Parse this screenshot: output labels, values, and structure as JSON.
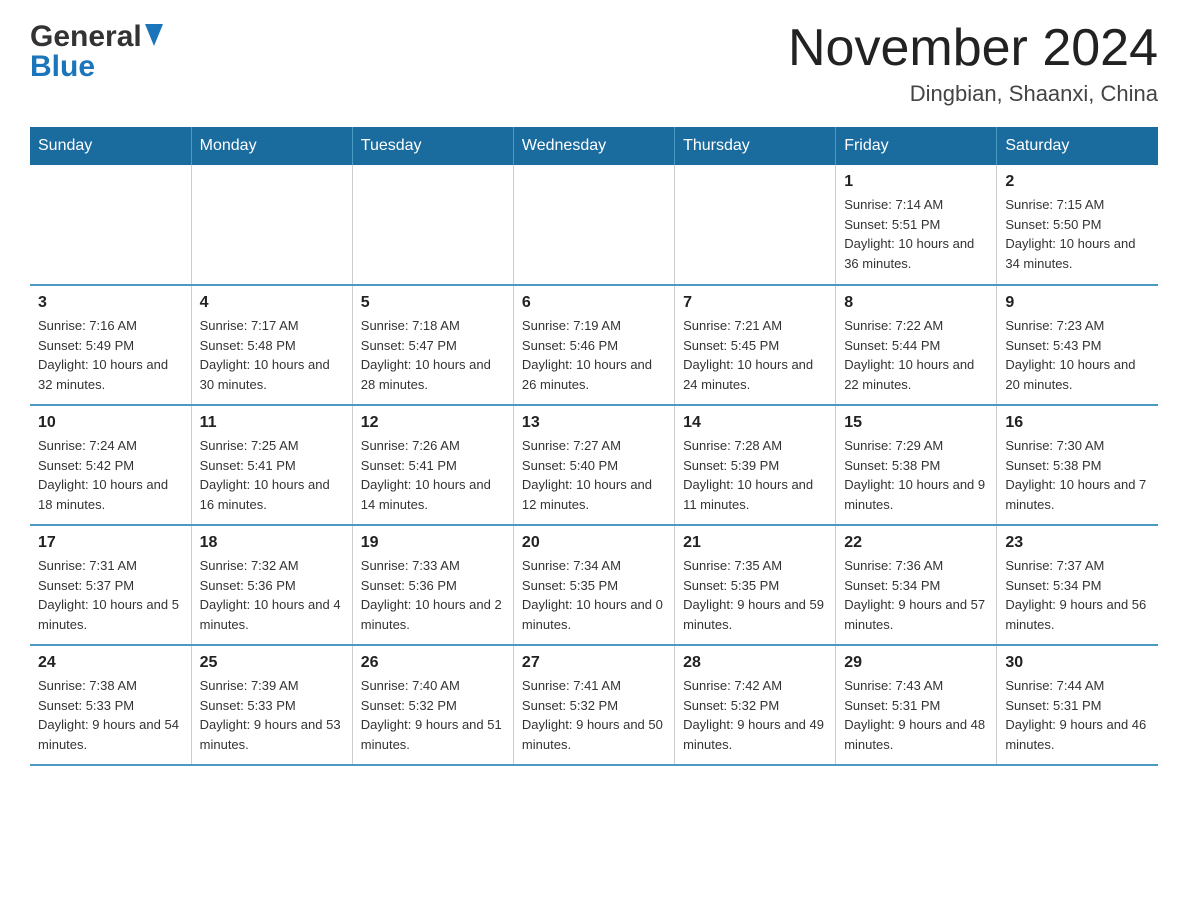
{
  "header": {
    "logo_general": "General",
    "logo_blue": "Blue",
    "month_title": "November 2024",
    "location": "Dingbian, Shaanxi, China"
  },
  "weekdays": [
    "Sunday",
    "Monday",
    "Tuesday",
    "Wednesday",
    "Thursday",
    "Friday",
    "Saturday"
  ],
  "weeks": [
    {
      "days": [
        {
          "num": "",
          "sunrise": "",
          "sunset": "",
          "daylight": ""
        },
        {
          "num": "",
          "sunrise": "",
          "sunset": "",
          "daylight": ""
        },
        {
          "num": "",
          "sunrise": "",
          "sunset": "",
          "daylight": ""
        },
        {
          "num": "",
          "sunrise": "",
          "sunset": "",
          "daylight": ""
        },
        {
          "num": "",
          "sunrise": "",
          "sunset": "",
          "daylight": ""
        },
        {
          "num": "1",
          "sunrise": "Sunrise: 7:14 AM",
          "sunset": "Sunset: 5:51 PM",
          "daylight": "Daylight: 10 hours and 36 minutes."
        },
        {
          "num": "2",
          "sunrise": "Sunrise: 7:15 AM",
          "sunset": "Sunset: 5:50 PM",
          "daylight": "Daylight: 10 hours and 34 minutes."
        }
      ]
    },
    {
      "days": [
        {
          "num": "3",
          "sunrise": "Sunrise: 7:16 AM",
          "sunset": "Sunset: 5:49 PM",
          "daylight": "Daylight: 10 hours and 32 minutes."
        },
        {
          "num": "4",
          "sunrise": "Sunrise: 7:17 AM",
          "sunset": "Sunset: 5:48 PM",
          "daylight": "Daylight: 10 hours and 30 minutes."
        },
        {
          "num": "5",
          "sunrise": "Sunrise: 7:18 AM",
          "sunset": "Sunset: 5:47 PM",
          "daylight": "Daylight: 10 hours and 28 minutes."
        },
        {
          "num": "6",
          "sunrise": "Sunrise: 7:19 AM",
          "sunset": "Sunset: 5:46 PM",
          "daylight": "Daylight: 10 hours and 26 minutes."
        },
        {
          "num": "7",
          "sunrise": "Sunrise: 7:21 AM",
          "sunset": "Sunset: 5:45 PM",
          "daylight": "Daylight: 10 hours and 24 minutes."
        },
        {
          "num": "8",
          "sunrise": "Sunrise: 7:22 AM",
          "sunset": "Sunset: 5:44 PM",
          "daylight": "Daylight: 10 hours and 22 minutes."
        },
        {
          "num": "9",
          "sunrise": "Sunrise: 7:23 AM",
          "sunset": "Sunset: 5:43 PM",
          "daylight": "Daylight: 10 hours and 20 minutes."
        }
      ]
    },
    {
      "days": [
        {
          "num": "10",
          "sunrise": "Sunrise: 7:24 AM",
          "sunset": "Sunset: 5:42 PM",
          "daylight": "Daylight: 10 hours and 18 minutes."
        },
        {
          "num": "11",
          "sunrise": "Sunrise: 7:25 AM",
          "sunset": "Sunset: 5:41 PM",
          "daylight": "Daylight: 10 hours and 16 minutes."
        },
        {
          "num": "12",
          "sunrise": "Sunrise: 7:26 AM",
          "sunset": "Sunset: 5:41 PM",
          "daylight": "Daylight: 10 hours and 14 minutes."
        },
        {
          "num": "13",
          "sunrise": "Sunrise: 7:27 AM",
          "sunset": "Sunset: 5:40 PM",
          "daylight": "Daylight: 10 hours and 12 minutes."
        },
        {
          "num": "14",
          "sunrise": "Sunrise: 7:28 AM",
          "sunset": "Sunset: 5:39 PM",
          "daylight": "Daylight: 10 hours and 11 minutes."
        },
        {
          "num": "15",
          "sunrise": "Sunrise: 7:29 AM",
          "sunset": "Sunset: 5:38 PM",
          "daylight": "Daylight: 10 hours and 9 minutes."
        },
        {
          "num": "16",
          "sunrise": "Sunrise: 7:30 AM",
          "sunset": "Sunset: 5:38 PM",
          "daylight": "Daylight: 10 hours and 7 minutes."
        }
      ]
    },
    {
      "days": [
        {
          "num": "17",
          "sunrise": "Sunrise: 7:31 AM",
          "sunset": "Sunset: 5:37 PM",
          "daylight": "Daylight: 10 hours and 5 minutes."
        },
        {
          "num": "18",
          "sunrise": "Sunrise: 7:32 AM",
          "sunset": "Sunset: 5:36 PM",
          "daylight": "Daylight: 10 hours and 4 minutes."
        },
        {
          "num": "19",
          "sunrise": "Sunrise: 7:33 AM",
          "sunset": "Sunset: 5:36 PM",
          "daylight": "Daylight: 10 hours and 2 minutes."
        },
        {
          "num": "20",
          "sunrise": "Sunrise: 7:34 AM",
          "sunset": "Sunset: 5:35 PM",
          "daylight": "Daylight: 10 hours and 0 minutes."
        },
        {
          "num": "21",
          "sunrise": "Sunrise: 7:35 AM",
          "sunset": "Sunset: 5:35 PM",
          "daylight": "Daylight: 9 hours and 59 minutes."
        },
        {
          "num": "22",
          "sunrise": "Sunrise: 7:36 AM",
          "sunset": "Sunset: 5:34 PM",
          "daylight": "Daylight: 9 hours and 57 minutes."
        },
        {
          "num": "23",
          "sunrise": "Sunrise: 7:37 AM",
          "sunset": "Sunset: 5:34 PM",
          "daylight": "Daylight: 9 hours and 56 minutes."
        }
      ]
    },
    {
      "days": [
        {
          "num": "24",
          "sunrise": "Sunrise: 7:38 AM",
          "sunset": "Sunset: 5:33 PM",
          "daylight": "Daylight: 9 hours and 54 minutes."
        },
        {
          "num": "25",
          "sunrise": "Sunrise: 7:39 AM",
          "sunset": "Sunset: 5:33 PM",
          "daylight": "Daylight: 9 hours and 53 minutes."
        },
        {
          "num": "26",
          "sunrise": "Sunrise: 7:40 AM",
          "sunset": "Sunset: 5:32 PM",
          "daylight": "Daylight: 9 hours and 51 minutes."
        },
        {
          "num": "27",
          "sunrise": "Sunrise: 7:41 AM",
          "sunset": "Sunset: 5:32 PM",
          "daylight": "Daylight: 9 hours and 50 minutes."
        },
        {
          "num": "28",
          "sunrise": "Sunrise: 7:42 AM",
          "sunset": "Sunset: 5:32 PM",
          "daylight": "Daylight: 9 hours and 49 minutes."
        },
        {
          "num": "29",
          "sunrise": "Sunrise: 7:43 AM",
          "sunset": "Sunset: 5:31 PM",
          "daylight": "Daylight: 9 hours and 48 minutes."
        },
        {
          "num": "30",
          "sunrise": "Sunrise: 7:44 AM",
          "sunset": "Sunset: 5:31 PM",
          "daylight": "Daylight: 9 hours and 46 minutes."
        }
      ]
    }
  ]
}
